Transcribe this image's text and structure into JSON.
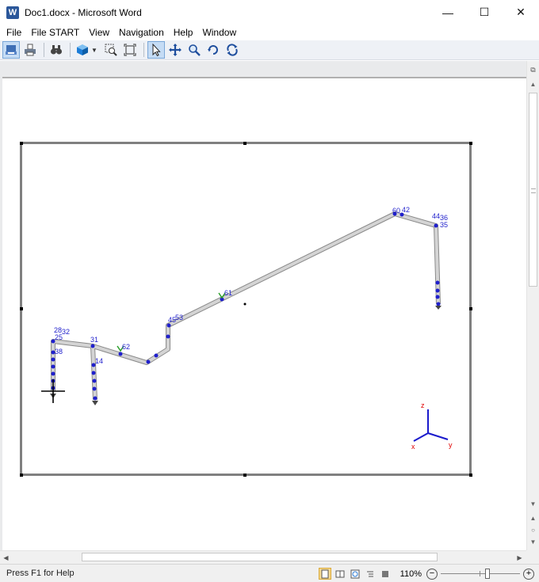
{
  "window": {
    "title": "Doc1.docx - Microsoft Word",
    "app_icon_letter": "W",
    "minimize": "—",
    "maximize": "☐",
    "close": "✕"
  },
  "menu": [
    "File",
    "File START",
    "View",
    "Navigation",
    "Help",
    "Window"
  ],
  "toolbar": {
    "buttons": [
      "print-preview",
      "print-setup",
      "find",
      "3d-view",
      "zoom-window",
      "zoom-extents",
      "select",
      "pan",
      "zoom",
      "rotate",
      "orbit"
    ]
  },
  "model": {
    "node_labels": [
      {
        "id": "n60",
        "text": "60"
      },
      {
        "id": "n42",
        "text": "42"
      },
      {
        "id": "n44",
        "text": "44"
      },
      {
        "id": "n36",
        "text": "36"
      },
      {
        "id": "n35",
        "text": "35"
      },
      {
        "id": "n61",
        "text": "61"
      },
      {
        "id": "n45",
        "text": "45"
      },
      {
        "id": "n53",
        "text": "53"
      },
      {
        "id": "n62",
        "text": "62"
      },
      {
        "id": "n28",
        "text": "28"
      },
      {
        "id": "n32",
        "text": "32"
      },
      {
        "id": "n31",
        "text": "31"
      },
      {
        "id": "n25",
        "text": "25"
      },
      {
        "id": "n38",
        "text": "38"
      },
      {
        "id": "n14",
        "text": "14"
      }
    ],
    "axis": {
      "z": "z",
      "x": "x",
      "y": "y"
    },
    "colors": {
      "pipe": "#c8c8c8",
      "node": "#1f1fcc",
      "axis_line": "#1a1acc",
      "axis_label": "#e00000",
      "support": "#2ca02c"
    }
  },
  "status": {
    "help_text": "Press F1 for Help",
    "zoom": "110%",
    "zoom_out": "−",
    "zoom_in": "+"
  }
}
